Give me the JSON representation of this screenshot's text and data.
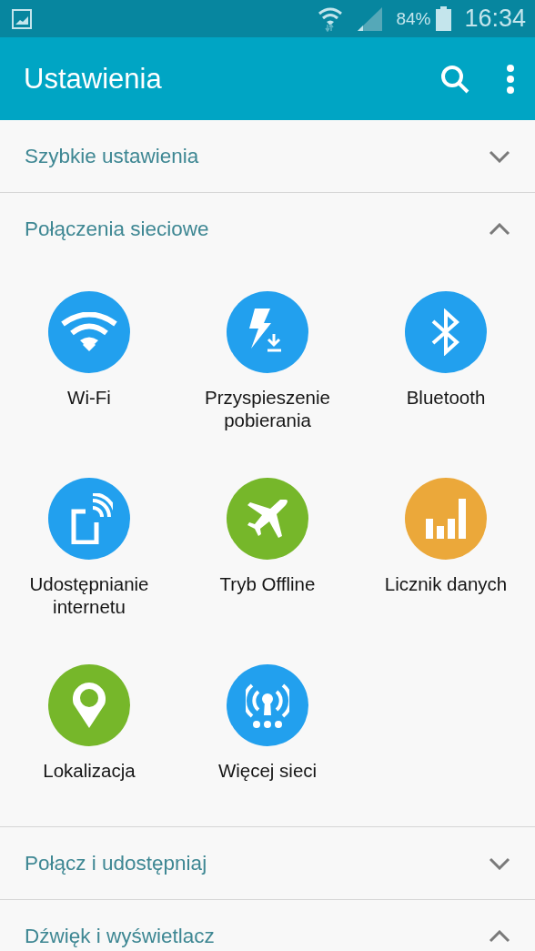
{
  "status_bar": {
    "battery_text": "84%",
    "time": "16:34"
  },
  "app_bar": {
    "title": "Ustawienia"
  },
  "sections": [
    {
      "title": "Szybkie ustawienia",
      "expanded": false
    },
    {
      "title": "Połączenia sieciowe",
      "expanded": true,
      "items": [
        {
          "label": "Wi-Fi",
          "color": "#22a0ee"
        },
        {
          "label": "Przyspieszenie pobierania",
          "color": "#22a0ee"
        },
        {
          "label": "Bluetooth",
          "color": "#22a0ee"
        },
        {
          "label": "Udostępnianie internetu",
          "color": "#22a0ee"
        },
        {
          "label": "Tryb Offline",
          "color": "#76b72a"
        },
        {
          "label": "Licznik danych",
          "color": "#eba83a"
        },
        {
          "label": "Lokalizacja",
          "color": "#76b72a"
        },
        {
          "label": "Więcej sieci",
          "color": "#22a0ee"
        }
      ]
    },
    {
      "title": "Połącz i udostępniaj",
      "expanded": false
    },
    {
      "title": "Dźwięk i wyświetlacz",
      "expanded": true
    }
  ]
}
